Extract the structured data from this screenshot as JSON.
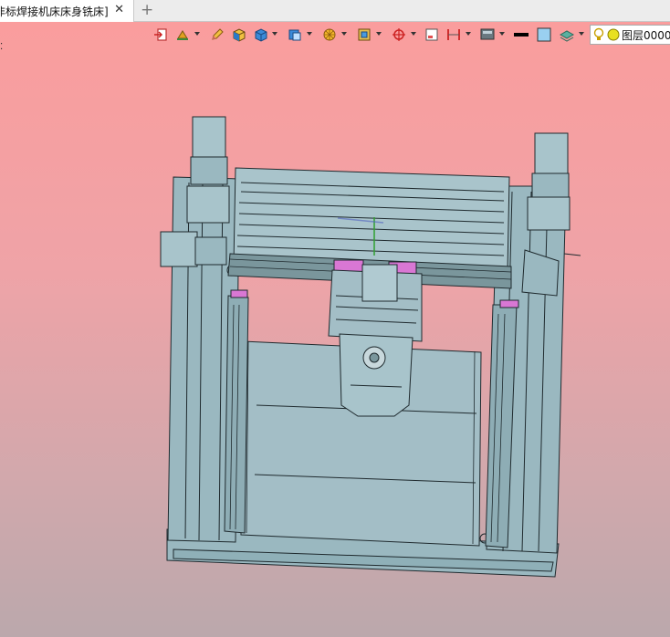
{
  "tab": {
    "title": "非标焊接机床床身铣床]",
    "close_glyph": "✕"
  },
  "new_tab_glyph": "+",
  "viewport": {
    "marker": "⁚"
  },
  "toolbar": {
    "icons": [
      "exit-icon",
      "paint-icon",
      "pencil-icon",
      "solid-box-icon",
      "blue-box-icon",
      "view-cube-icon",
      "render-style-icon",
      "section-view-icon",
      "pivot-icon",
      "frame-icon",
      "dimension-icon",
      "display-icon",
      "line-color-icon",
      "fill-color-icon",
      "layer-stack-icon"
    ],
    "layer": {
      "name": "图层0000"
    }
  },
  "colors": {
    "model_fill": "#9ab8c0",
    "model_stroke": "#1f2a2e",
    "highlight": "#d977d4",
    "background_top": "#fa9d9d",
    "background_bottom": "#bba8ac"
  }
}
